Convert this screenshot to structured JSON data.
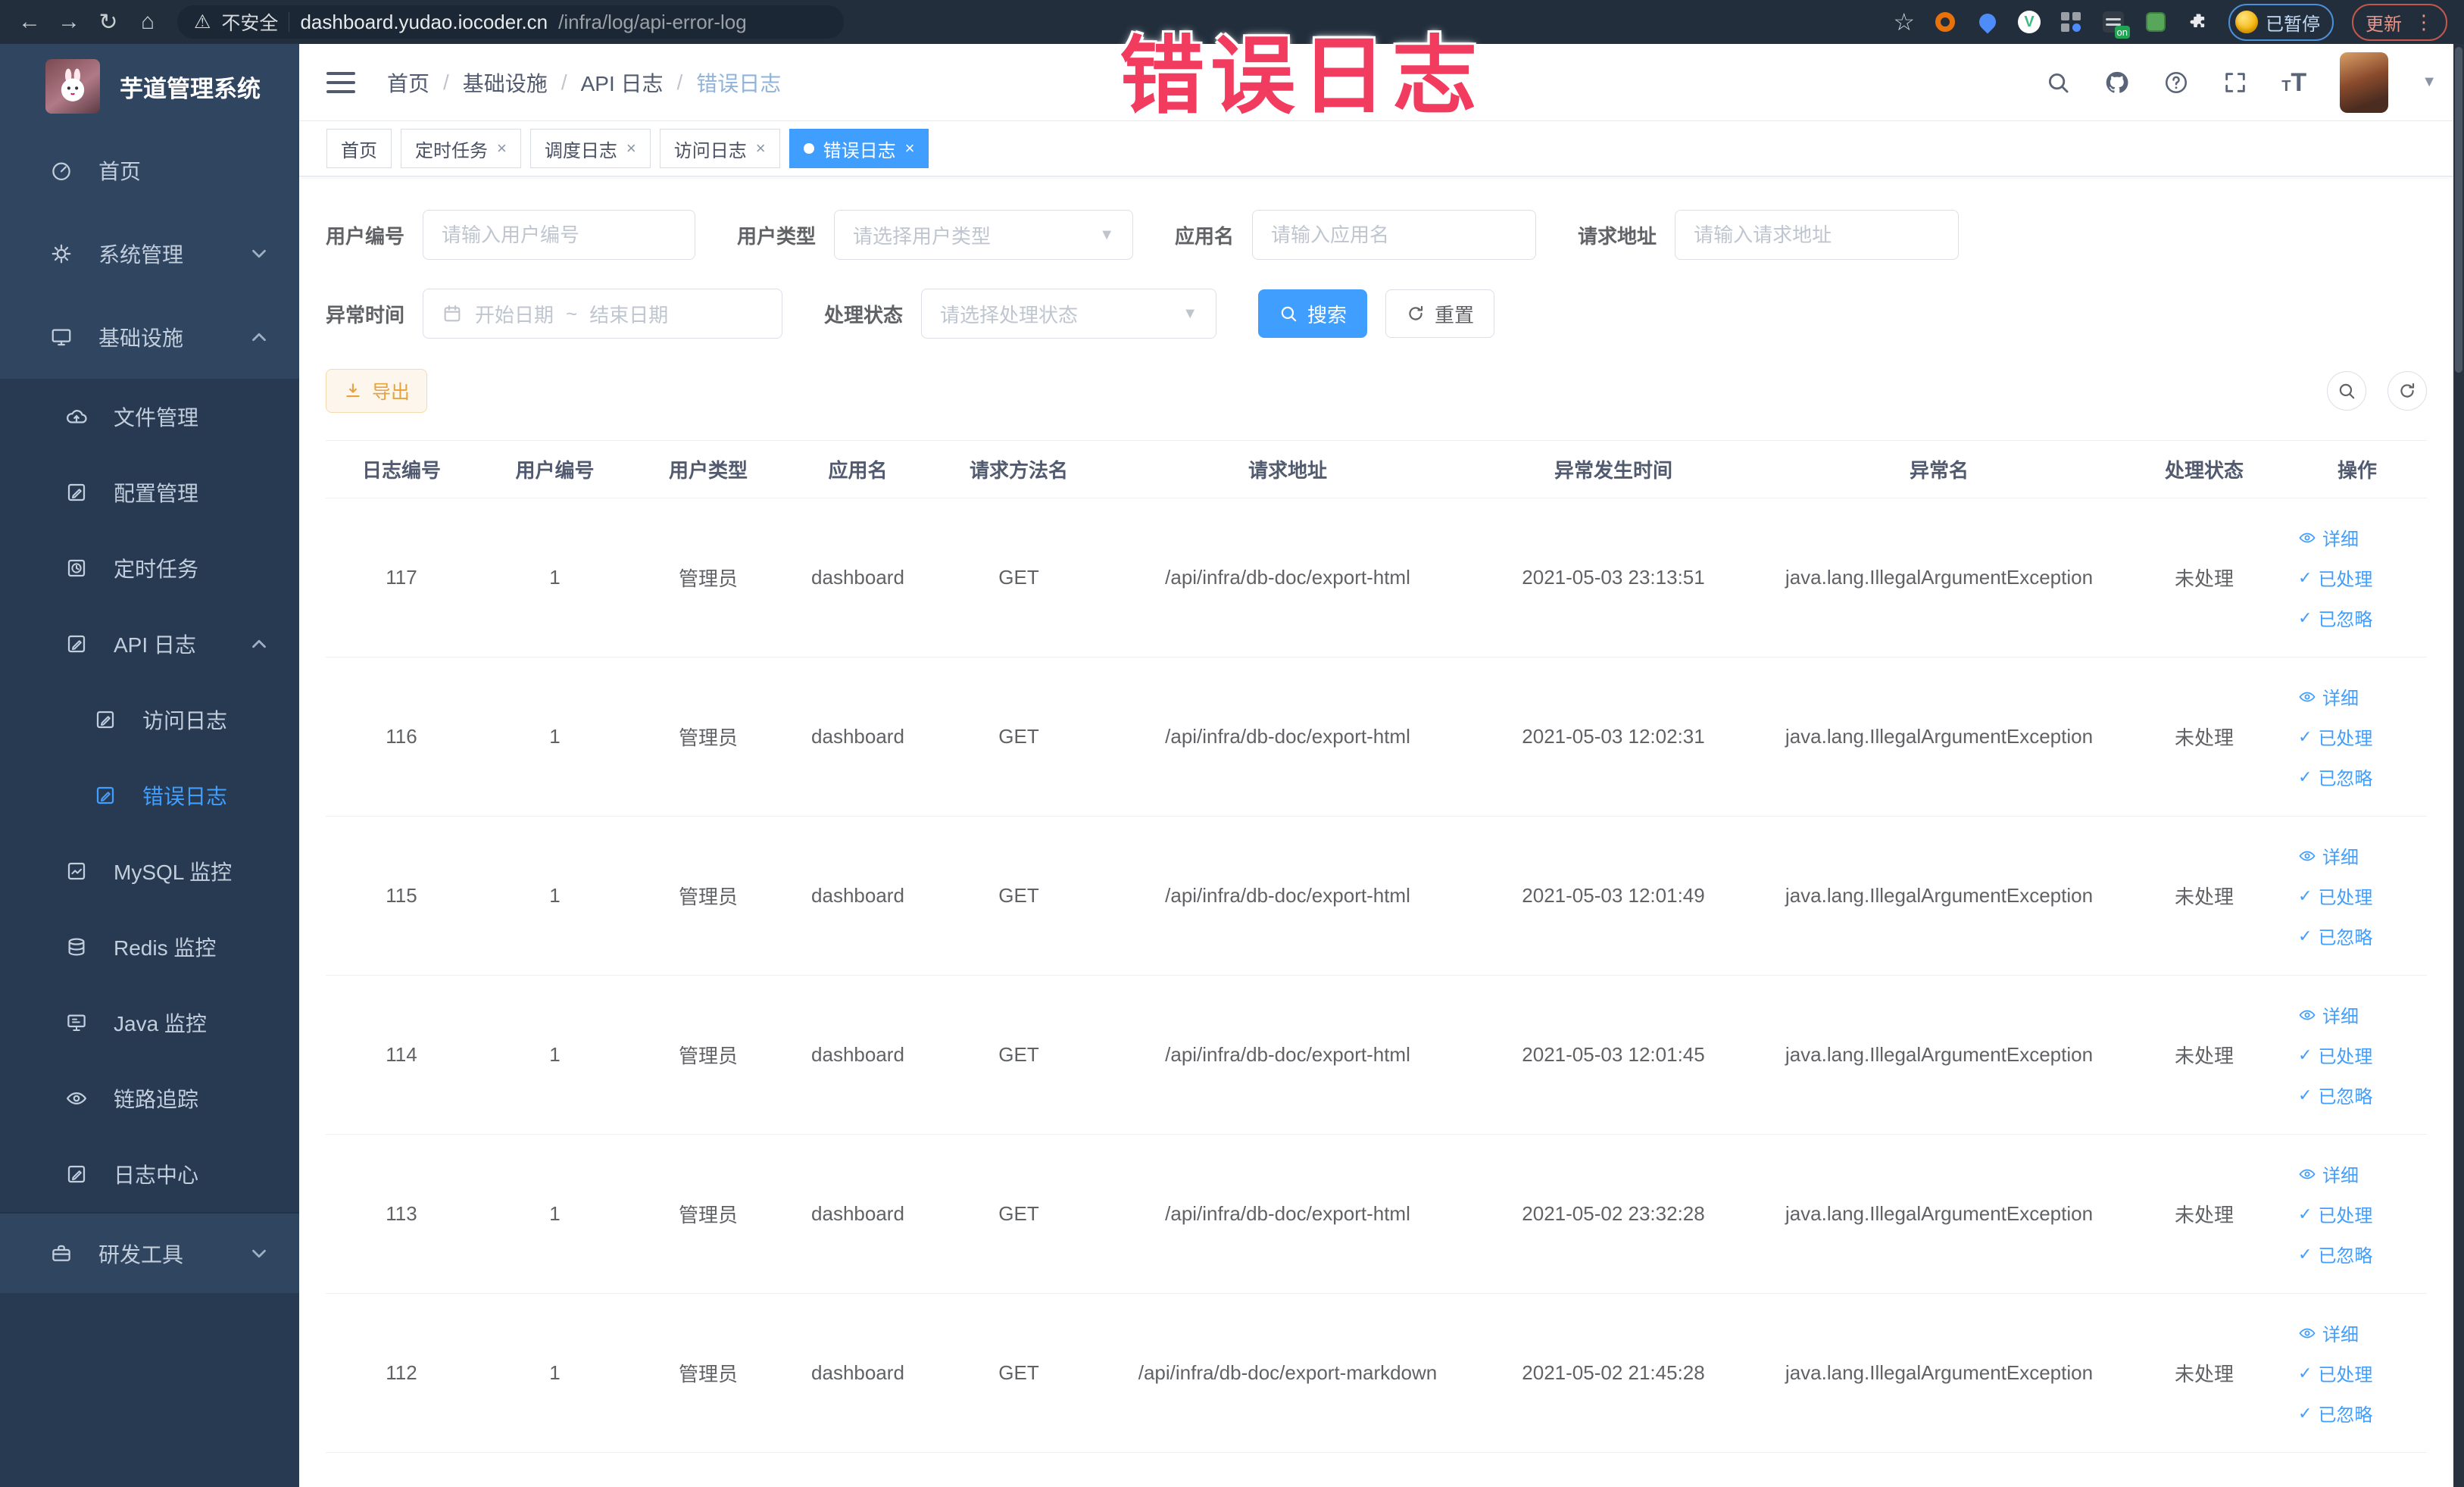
{
  "browser": {
    "security_label": "不安全",
    "url_domain": "dashboard.yudao.iocoder.cn",
    "url_path": "/infra/log/api-error-log",
    "on_badge": "on",
    "paused_label": "已暂停",
    "update_label": "更新"
  },
  "overlay_title": "错误日志",
  "colors": {
    "accent": "#409eff",
    "overlay_red": "#f23c5f",
    "export_orange": "#e6a23c",
    "sidebar_bg": "#2f4560",
    "submenu_bg": "#273a52"
  },
  "sidebar": {
    "logo_title": "芋道管理系统",
    "items": [
      {
        "label": "首页"
      },
      {
        "label": "系统管理"
      },
      {
        "label": "基础设施"
      },
      {
        "label": "文件管理"
      },
      {
        "label": "配置管理"
      },
      {
        "label": "定时任务"
      },
      {
        "label": "API 日志"
      },
      {
        "label": "访问日志"
      },
      {
        "label": "错误日志"
      },
      {
        "label": "MySQL 监控"
      },
      {
        "label": "Redis 监控"
      },
      {
        "label": "Java 监控"
      },
      {
        "label": "链路追踪"
      },
      {
        "label": "日志中心"
      },
      {
        "label": "研发工具"
      }
    ]
  },
  "breadcrumb": {
    "separator": "/",
    "items": [
      "首页",
      "基础设施",
      "API 日志",
      "错误日志"
    ]
  },
  "tabs": [
    {
      "label": "首页"
    },
    {
      "label": "定时任务"
    },
    {
      "label": "调度日志"
    },
    {
      "label": "访问日志"
    },
    {
      "label": "错误日志"
    }
  ],
  "filters": {
    "user_id": {
      "label": "用户编号",
      "placeholder": "请输入用户编号"
    },
    "user_type": {
      "label": "用户类型",
      "placeholder": "请选择用户类型"
    },
    "app_name": {
      "label": "应用名",
      "placeholder": "请输入应用名"
    },
    "request_url": {
      "label": "请求地址",
      "placeholder": "请输入请求地址"
    },
    "exception_time": {
      "label": "异常时间",
      "start_placeholder": "开始日期",
      "separator": "~",
      "end_placeholder": "结束日期"
    },
    "process_status": {
      "label": "处理状态",
      "placeholder": "请选择处理状态"
    },
    "search_label": "搜索",
    "reset_label": "重置"
  },
  "toolbar": {
    "export_label": "导出"
  },
  "table": {
    "columns": [
      "日志编号",
      "用户编号",
      "用户类型",
      "应用名",
      "请求方法名",
      "请求地址",
      "异常发生时间",
      "异常名",
      "处理状态",
      "操作"
    ],
    "actions": {
      "detail": "详细",
      "processed": "已处理",
      "ignored": "已忽略"
    },
    "rows": [
      {
        "id": "117",
        "user_id": "1",
        "user_type": "管理员",
        "app_name": "dashboard",
        "method": "GET",
        "url": "/api/infra/db-doc/export-html",
        "time": "2021-05-03 23:13:51",
        "exception": "java.lang.IllegalArgumentException",
        "status": "未处理"
      },
      {
        "id": "116",
        "user_id": "1",
        "user_type": "管理员",
        "app_name": "dashboard",
        "method": "GET",
        "url": "/api/infra/db-doc/export-html",
        "time": "2021-05-03 12:02:31",
        "exception": "java.lang.IllegalArgumentException",
        "status": "未处理"
      },
      {
        "id": "115",
        "user_id": "1",
        "user_type": "管理员",
        "app_name": "dashboard",
        "method": "GET",
        "url": "/api/infra/db-doc/export-html",
        "time": "2021-05-03 12:01:49",
        "exception": "java.lang.IllegalArgumentException",
        "status": "未处理"
      },
      {
        "id": "114",
        "user_id": "1",
        "user_type": "管理员",
        "app_name": "dashboard",
        "method": "GET",
        "url": "/api/infra/db-doc/export-html",
        "time": "2021-05-03 12:01:45",
        "exception": "java.lang.IllegalArgumentException",
        "status": "未处理"
      },
      {
        "id": "113",
        "user_id": "1",
        "user_type": "管理员",
        "app_name": "dashboard",
        "method": "GET",
        "url": "/api/infra/db-doc/export-html",
        "time": "2021-05-02 23:32:28",
        "exception": "java.lang.IllegalArgumentException",
        "status": "未处理"
      },
      {
        "id": "112",
        "user_id": "1",
        "user_type": "管理员",
        "app_name": "dashboard",
        "method": "GET",
        "url": "/api/infra/db-doc/export-markdown",
        "time": "2021-05-02 21:45:28",
        "exception": "java.lang.IllegalArgumentException",
        "status": "未处理"
      }
    ]
  }
}
